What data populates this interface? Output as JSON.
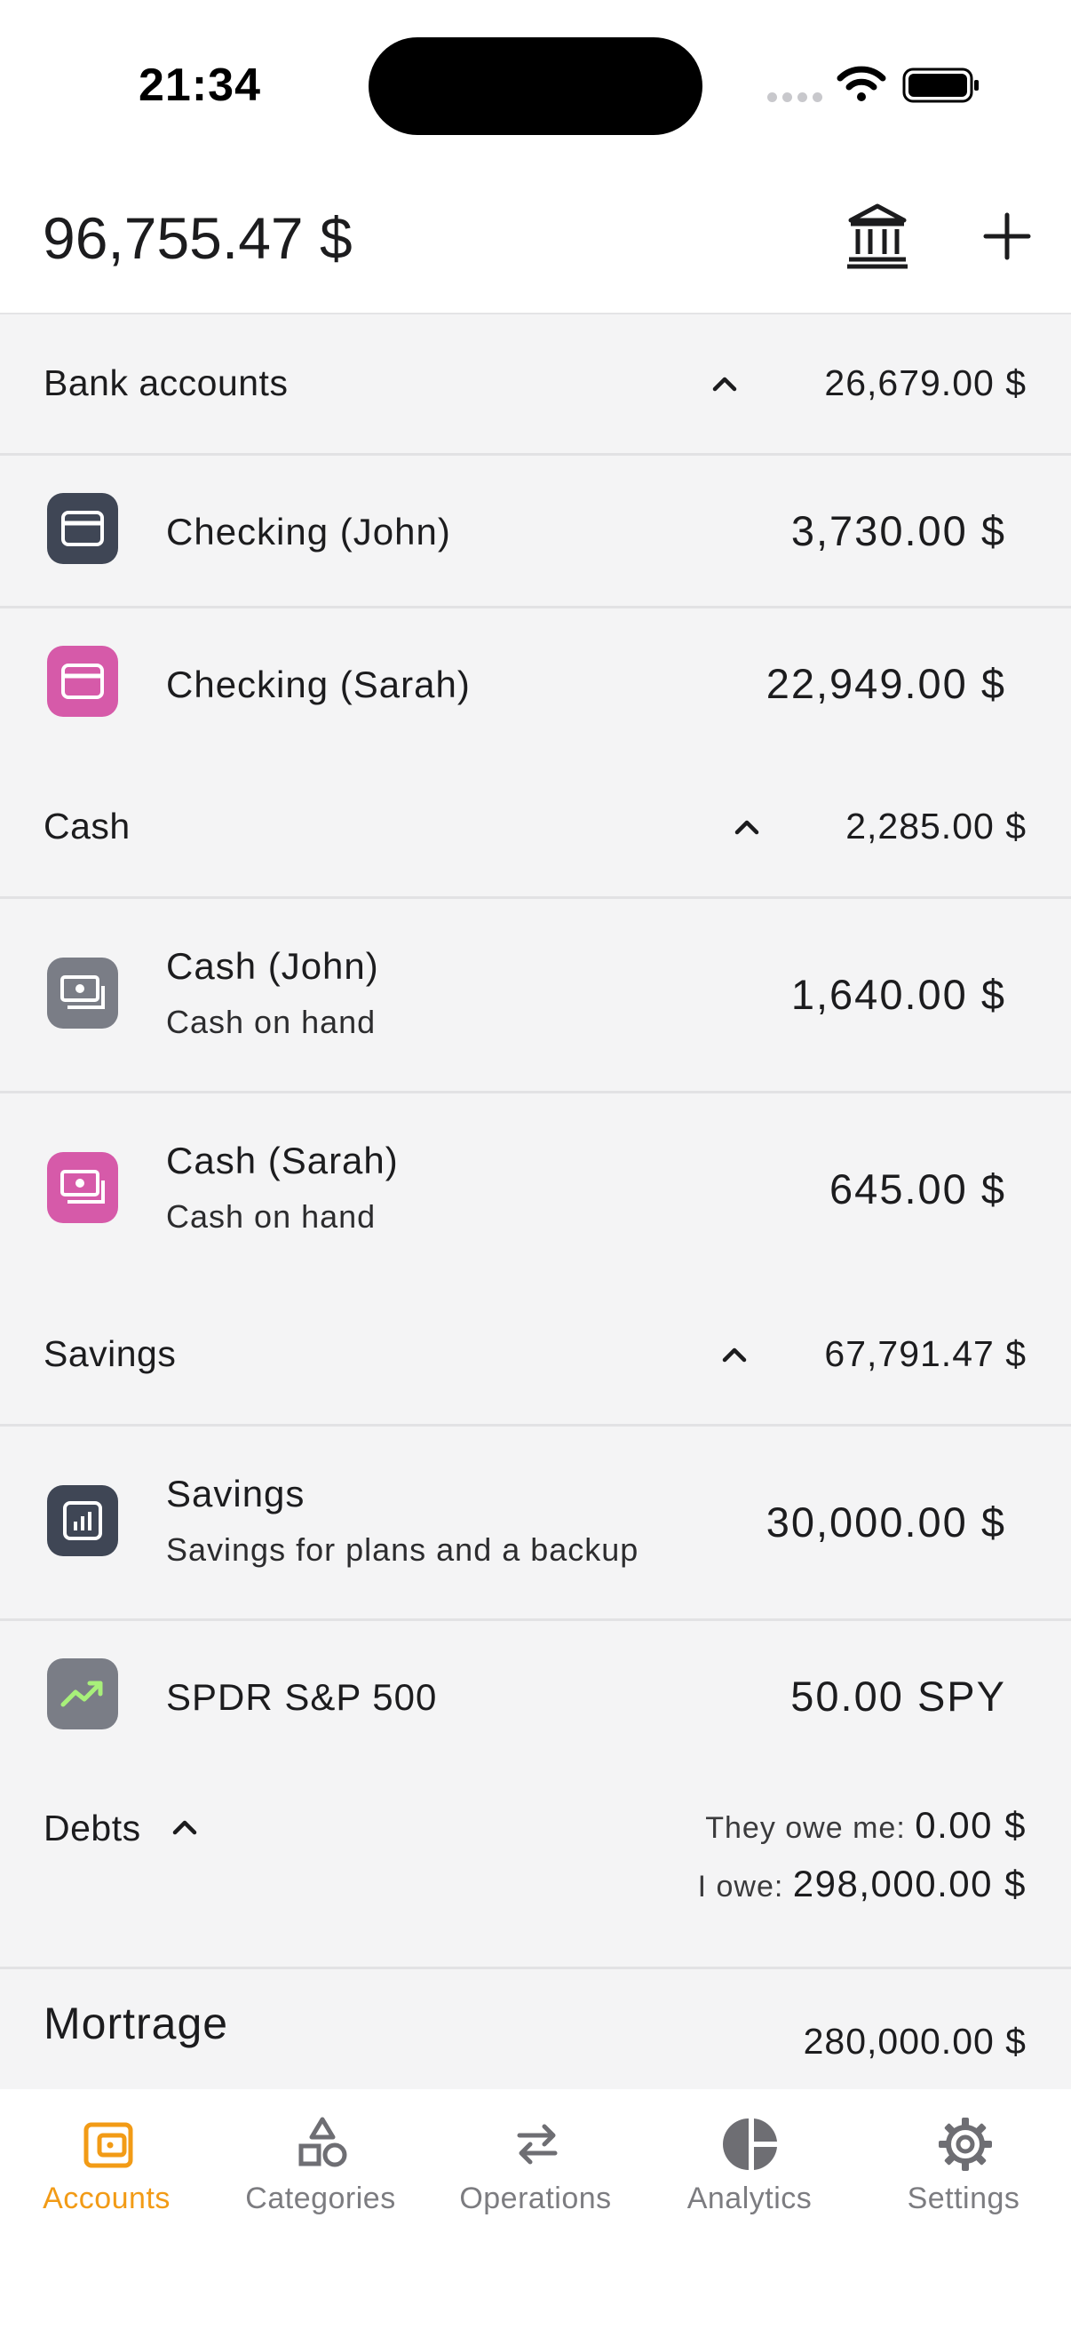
{
  "status": {
    "time": "21:34"
  },
  "header": {
    "total": "96,755.47 $"
  },
  "groups": {
    "bank": {
      "title": "Bank accounts",
      "total": "26,679.00 $"
    },
    "cash": {
      "title": "Cash",
      "total": "2,285.00 $"
    },
    "savings": {
      "title": "Savings",
      "total": "67,791.47 $"
    }
  },
  "accounts": [
    {
      "name": "Checking (John)",
      "sub": "",
      "amount": "3,730.00 $",
      "icon": "card-icon",
      "color": "#3f4655"
    },
    {
      "name": "Checking (Sarah)",
      "sub": "",
      "amount": "22,949.00 $",
      "icon": "card-icon",
      "color": "#d65aa9"
    },
    {
      "name": "Cash (John)",
      "sub": "Cash on hand",
      "amount": "1,640.00 $",
      "icon": "cash-icon",
      "color": "#7a7d86"
    },
    {
      "name": "Cash (Sarah)",
      "sub": "Cash on hand",
      "amount": "645.00 $",
      "icon": "cash-icon",
      "color": "#d65aa9"
    },
    {
      "name": "Savings",
      "sub": "Savings for plans and a backup",
      "amount": "30,000.00 $",
      "icon": "chart-icon",
      "color": "#3f4655"
    },
    {
      "name": "SPDR S&P 500",
      "sub": "",
      "amount": "50.00 SPY",
      "icon": "trend-icon",
      "color": "#7a7d86"
    }
  ],
  "debts": {
    "title": "Debts",
    "they_owe_label": "They owe me:",
    "they_owe_value": "0.00 $",
    "i_owe_label": "I owe:",
    "i_owe_value": "298,000.00 $",
    "mortgage_name": "Mortrage",
    "mortgage_amount": "280,000.00 $"
  },
  "tabs": [
    {
      "label": "Accounts",
      "icon": "wallet-icon",
      "active": true
    },
    {
      "label": "Categories",
      "icon": "shapes-icon",
      "active": false
    },
    {
      "label": "Operations",
      "icon": "arrows-icon",
      "active": false
    },
    {
      "label": "Analytics",
      "icon": "pie-icon",
      "active": false
    },
    {
      "label": "Settings",
      "icon": "gear-icon",
      "active": false
    }
  ],
  "colors": {
    "accent": "#f29b16",
    "inactive_tab": "#7c7c80",
    "background": "#f4f4f5"
  }
}
